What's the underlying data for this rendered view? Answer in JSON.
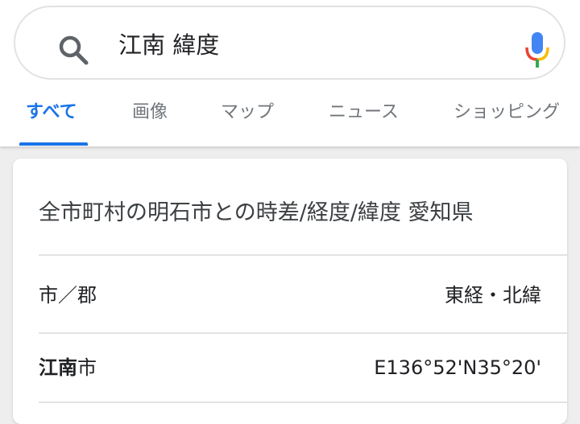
{
  "search": {
    "query": "江南 緯度"
  },
  "tabs": [
    {
      "label": "すべて",
      "active": true
    },
    {
      "label": "画像",
      "active": false
    },
    {
      "label": "マップ",
      "active": false
    },
    {
      "label": "ニュース",
      "active": false
    },
    {
      "label": "ショッピング",
      "active": false
    }
  ],
  "result": {
    "title": "全市町村の明石市との時差/経度/緯度 愛知県",
    "header": {
      "col1": "市／郡",
      "col2": "東経・北緯"
    },
    "row": {
      "city_bold": "江南",
      "city_suffix": "市",
      "coords": "E136°52'N35°20'"
    }
  },
  "colors": {
    "accent": "#1a73e8",
    "mic_blue": "#4285f4",
    "mic_red": "#ea4335",
    "mic_yellow": "#fbbc05",
    "mic_green": "#34a853"
  },
  "icons": [
    "search-icon",
    "mic-icon"
  ]
}
